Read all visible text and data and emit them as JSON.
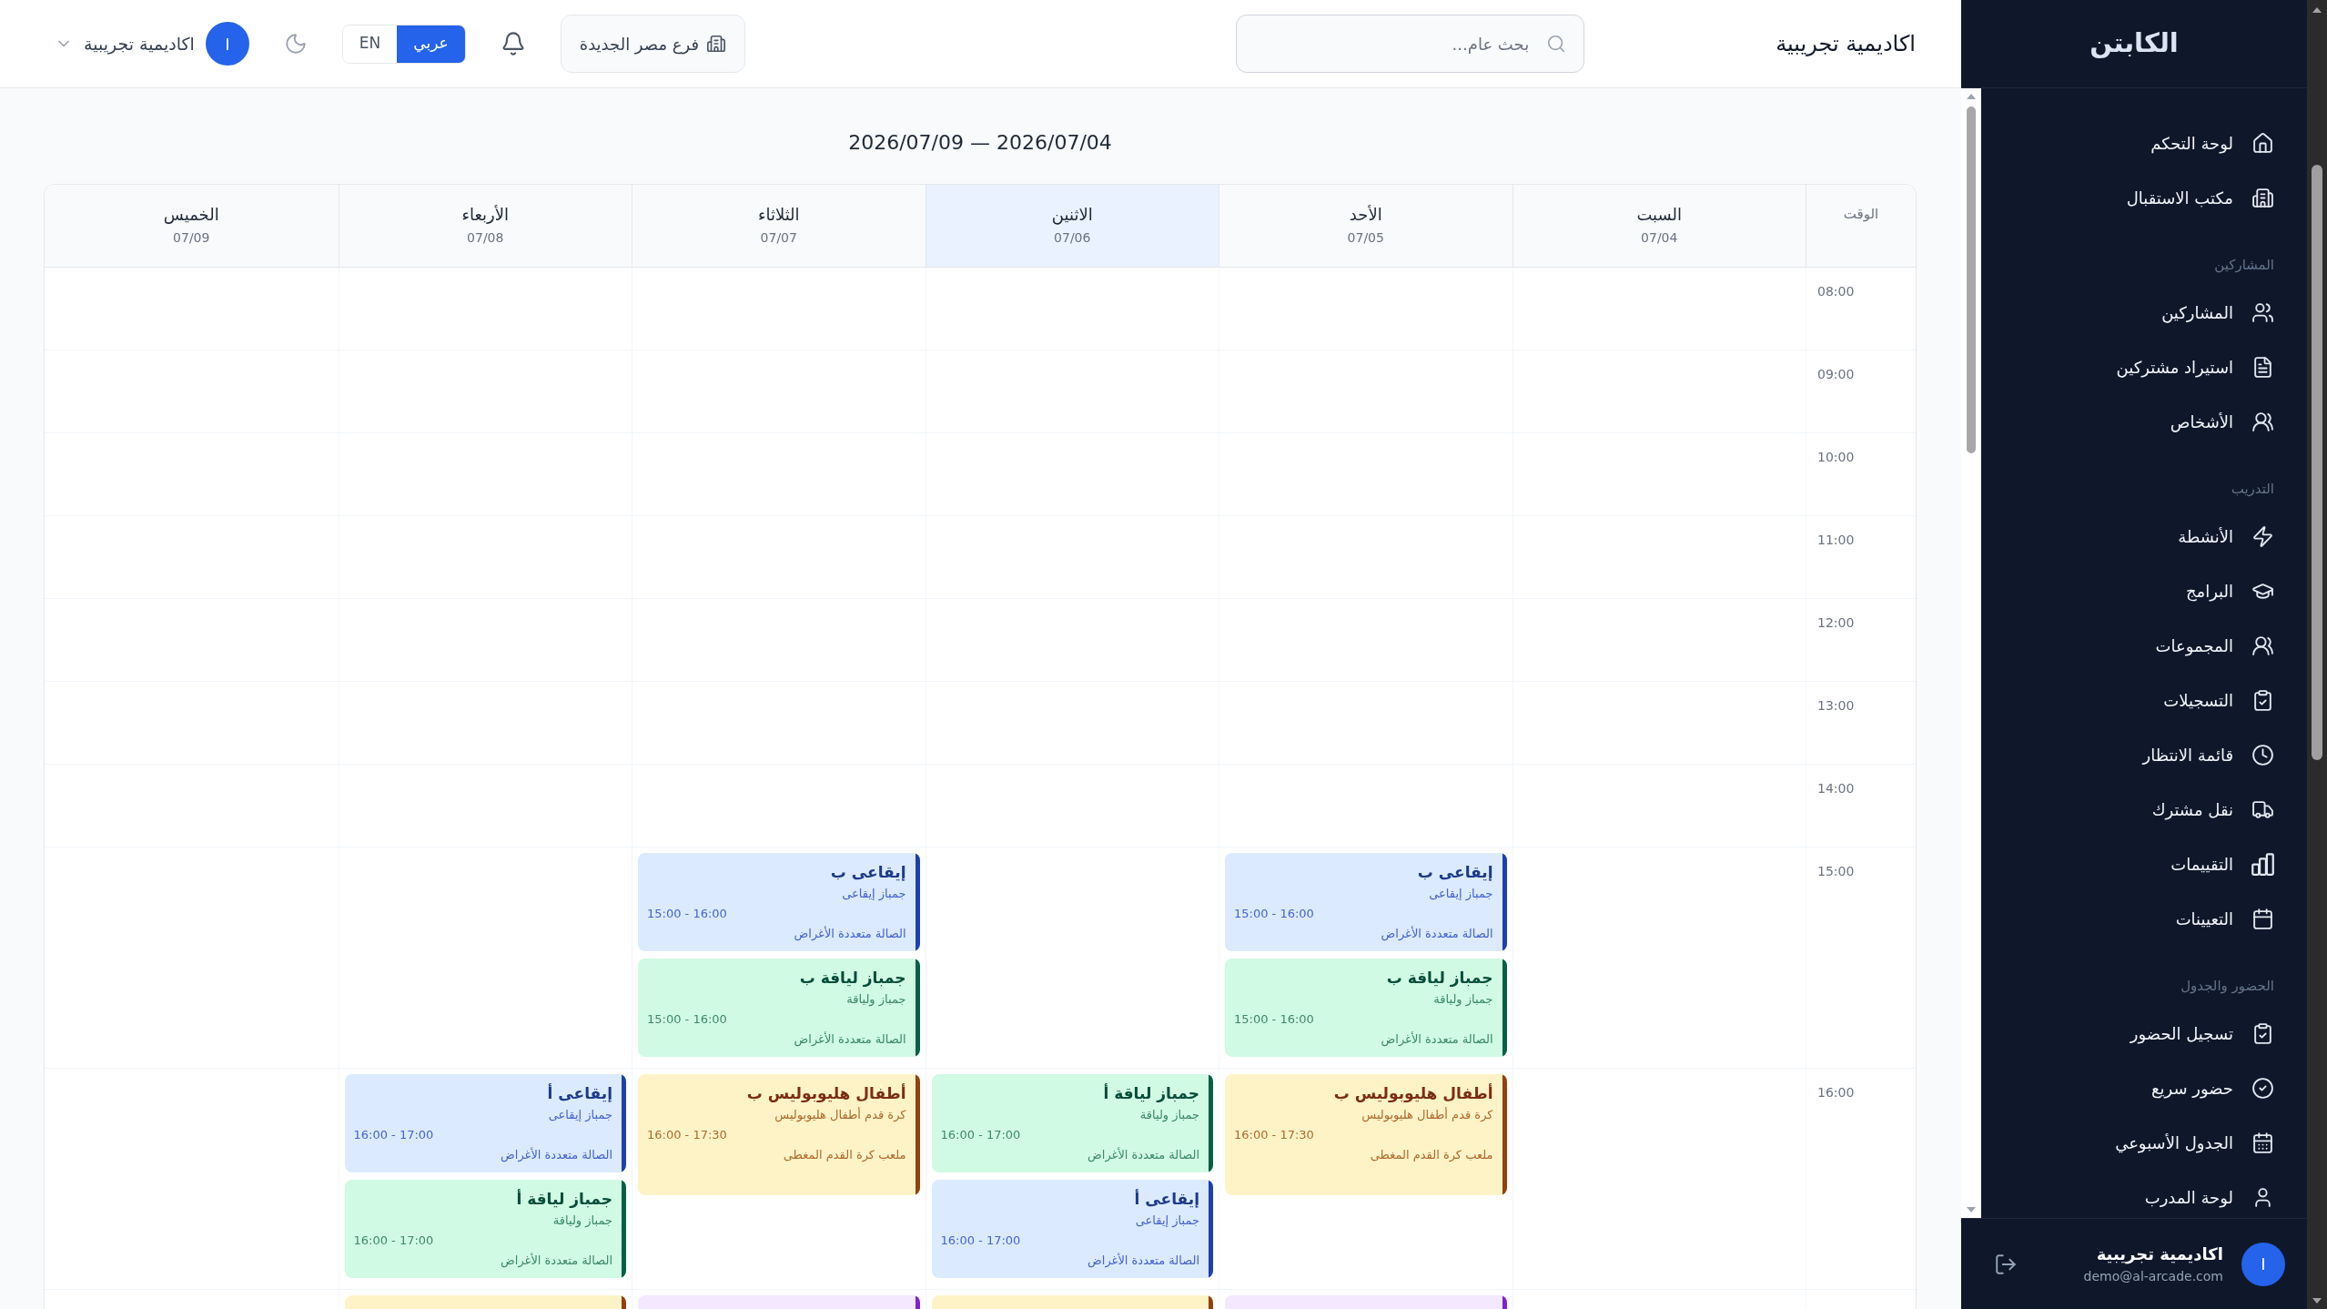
{
  "sidebar": {
    "brand": "الكابتن",
    "sections": [
      {
        "items": [
          "لوحة التحكم",
          "مكتب الاستقبال"
        ]
      },
      {
        "title": "المشاركين",
        "items": [
          "المشاركين",
          "استيراد مشتركين",
          "الأشخاص"
        ]
      },
      {
        "title": "التدريب",
        "items": [
          "الأنشطة",
          "البرامج",
          "المجموعات",
          "التسجيلات",
          "قائمة الانتظار",
          "نقل مشترك",
          "التقييمات",
          "التعيينات"
        ]
      },
      {
        "title": "الحضور والجدول",
        "items": [
          "تسجيل الحضور",
          "حضور سريع",
          "الجدول الأسبوعي",
          "لوحة المدرب"
        ]
      }
    ],
    "user": {
      "avatar": "I",
      "name": "اكاديمية تجريبية",
      "email": "demo@al-arcade.com"
    }
  },
  "header": {
    "title": "اكاديمية تجريبية",
    "search": {
      "placeholder": "بحث عام..."
    },
    "branch": "فرع مصر الجديدة",
    "languages": [
      {
        "label": "عربي",
        "selected": true
      },
      {
        "label": "EN",
        "selected": false
      }
    ],
    "user": {
      "avatar": "I",
      "name": "اكاديمية تجريبية"
    }
  },
  "schedule": {
    "range": "2026/07/04 — 2026/07/09",
    "time_heading": "الوقت",
    "days": [
      {
        "name": "السبت",
        "date": "07/04",
        "today": false
      },
      {
        "name": "الأحد",
        "date": "07/05",
        "today": false
      },
      {
        "name": "الاثنين",
        "date": "07/06",
        "today": true
      },
      {
        "name": "الثلاثاء",
        "date": "07/07",
        "today": false
      },
      {
        "name": "الأربعاء",
        "date": "07/08",
        "today": false
      },
      {
        "name": "الخميس",
        "date": "07/09",
        "today": false
      }
    ],
    "rows": [
      {
        "time": "08:00"
      },
      {
        "time": "09:00"
      },
      {
        "time": "10:00"
      },
      {
        "time": "11:00"
      },
      {
        "time": "12:00"
      },
      {
        "time": "13:00"
      },
      {
        "time": "14:00"
      },
      {
        "time": "15:00",
        "cells": [
          {},
          {
            "events": [
              {
                "title": "إيقاعى ب",
                "activity": "جمباز إيقاعى",
                "time": "15:00 - 16:00",
                "location": "الصالة متعددة الأغراض",
                "color": "#1e40af"
              },
              {
                "title": "جمباز لياقة ب",
                "activity": "جمباز ولياقة",
                "time": "15:00 - 16:00",
                "location": "الصالة متعددة الأغراض",
                "color": "#065f46"
              }
            ]
          },
          {},
          {
            "events": [
              {
                "title": "إيقاعى ب",
                "activity": "جمباز إيقاعى",
                "time": "15:00 - 16:00",
                "location": "الصالة متعددة الأغراض",
                "color": "#1e40af"
              },
              {
                "title": "جمباز لياقة ب",
                "activity": "جمباز ولياقة",
                "time": "15:00 - 16:00",
                "location": "الصالة متعددة الأغراض",
                "color": "#065f46"
              }
            ]
          },
          {},
          {}
        ]
      },
      {
        "time": "16:00",
        "cells": [
          {},
          {
            "events": [
              {
                "title": "أطفال هليوبوليس ب",
                "activity": "كرة قدم أطفال هليوبوليس",
                "time": "16:00 - 17:30",
                "location": "ملعب كرة القدم المغطى",
                "color": "#92400e"
              }
            ]
          },
          {
            "events": [
              {
                "title": "جمباز لياقة أ",
                "activity": "جمباز ولياقة",
                "time": "16:00 - 17:00",
                "location": "الصالة متعددة الأغراض",
                "color": "#065f46"
              },
              {
                "title": "إيقاعى أ",
                "activity": "جمباز إيقاعى",
                "time": "16:00 - 17:00",
                "location": "الصالة متعددة الأغراض",
                "color": "#1e40af"
              }
            ]
          },
          {
            "events": [
              {
                "title": "أطفال هليوبوليس ب",
                "activity": "كرة قدم أطفال هليوبوليس",
                "time": "16:00 - 17:30",
                "location": "ملعب كرة القدم المغطى",
                "color": "#92400e"
              }
            ]
          },
          {
            "events": [
              {
                "title": "إيقاعى أ",
                "activity": "جمباز إيقاعى",
                "time": "16:00 - 17:00",
                "location": "الصالة متعددة الأغراض",
                "color": "#1e40af"
              },
              {
                "title": "جمباز لياقة أ",
                "activity": "جمباز ولياقة",
                "time": "16:00 - 17:00",
                "location": "الصالة متعددة الأغراض",
                "color": "#065f46"
              }
            ]
          },
          {}
        ]
      },
      {
        "cells": [
          {},
          {
            "events": [
              {
                "color": "#7e22ce"
              }
            ]
          },
          {
            "events": [
              {
                "color": "#92400e"
              }
            ]
          },
          {
            "events": [
              {
                "color": "#7e22ce"
              }
            ]
          },
          {
            "events": [
              {
                "color": "#92400e"
              }
            ]
          },
          {}
        ]
      }
    ]
  }
}
